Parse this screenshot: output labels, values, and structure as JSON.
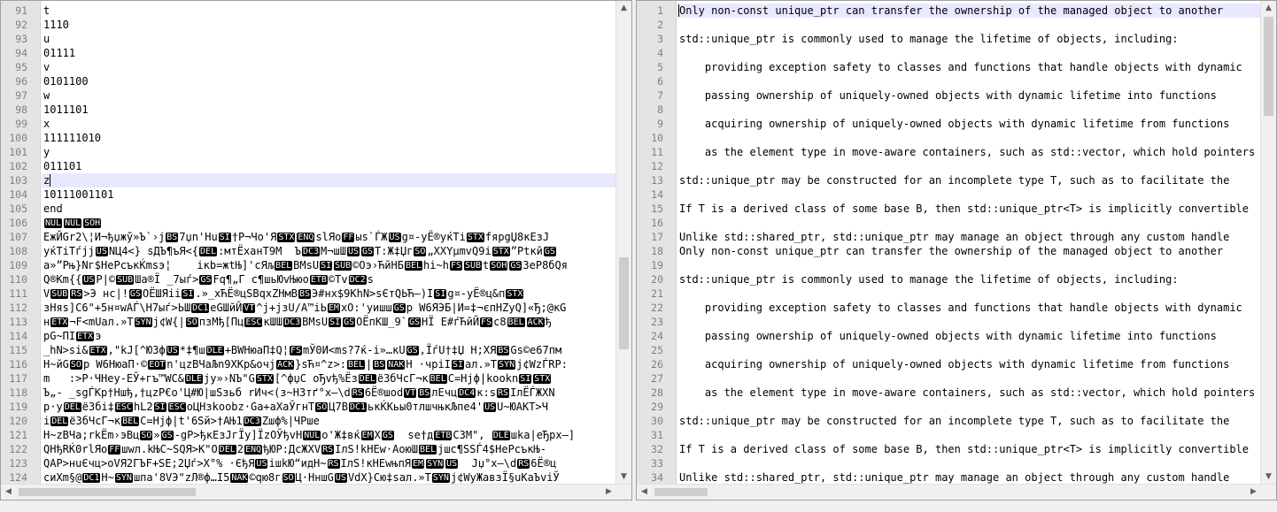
{
  "left": {
    "lines": [
      {
        "n": "91",
        "t": "t"
      },
      {
        "n": "92",
        "t": "1110"
      },
      {
        "n": "93",
        "t": "u"
      },
      {
        "n": "94",
        "t": "01111"
      },
      {
        "n": "95",
        "t": "v"
      },
      {
        "n": "96",
        "t": "0101100"
      },
      {
        "n": "97",
        "t": "w"
      },
      {
        "n": "98",
        "t": "1011101"
      },
      {
        "n": "99",
        "t": "x"
      },
      {
        "n": "100",
        "t": "111111010"
      },
      {
        "n": "101",
        "t": "y"
      },
      {
        "n": "102",
        "t": "011101"
      },
      {
        "n": "103",
        "t": "z",
        "hl": true
      },
      {
        "n": "104",
        "t": "10111001101"
      },
      {
        "n": "105",
        "t": "end"
      },
      {
        "n": "106",
        "t": "[NUL][NUL][SOH]"
      },
      {
        "n": "107",
        "t": "ЕжЙGr2\\¦И¬ђџжў»Ъ`›j[BS]7џn'Hu[SI]†Р¬Чо'Я[STX][ENQ]slЯо[FF]ыs`ЃЖ[US]g¤-уЁ®уќТі[STX]fяpgЏ8кЕзJ"
      },
      {
        "n": "108",
        "t": "уќТіТѓјј[US]NЦ4<} sДЪ¶ъЯ<{[DEL]:мтЁханТ9М  Ъ[DC3]М¬шШ[US][GS]T:Ж‡Џг[SO]„XXYµmvQ9і[STX]”Ptкй[GS]"
      },
      {
        "n": "109",
        "t": "а»”Рњ}Nг$НеРсъкЌmsэ¦    ікb=жtЊ]'сЯљ[BEL]ВМsU[SI][SUB]©Оэ›ЋйНБ[BEL]hі~h[FS][SUB]t[SOH][GS]ЗеР8бQя"
      },
      {
        "n": "110",
        "t": "Q®Кm{{[US]P|©[SUB]Ша®Ї _7ыѓ>[GS]Fq¶„Г с¶шьЮvЊюо[ETB]©Тv[DC2]s"
      },
      {
        "n": "111",
        "t": "V[SUB][RS]>Э нс|![GS]ОЁШЯіі[SI].»_хЋЁ®цSВqxZНмВ[BS]Э#нх$9КhN>sЄтQЬЋ—)I[SI]g¤-уЁ®ц&п[STX]"
      },
      {
        "n": "112",
        "t": "зНяs]С6\"+5н¤wАЃ\\Н7ыѓ>ЬШ[DC1]еGШйЙ[VT]^j+јзU/A™іЬ[EM]хО:'уишш[GS]р W6ЯЭБ|И=‡¬єпНZуQ]«Ђ;@кG"
      },
      {
        "n": "113",
        "t": "н[ETX]¬F<mUал.»Т[SYN]ј¢W{|[SO]пзМђ[Пц[ESC]кШШ[DC3]ВМsU[SI][GS]ОЁпКШ_9`[GS]НЇ Е#ѓЋйЙ[FS]с8[BEL][ACK]ђ"
      },
      {
        "n": "114",
        "t": "pG~ПІ[ETX]э"
      },
      {
        "n": "115",
        "t": "_hN>si&[ETX],\"kJ[^Ю3ф[US]*‡¶ш[DLE]+ВWНюаП‡Q¦[FS]mЎ0И<ms?7ќ-і»…кU[GS],ЇѓU†‡Џ Н;ХЯ[BS]Gs©е67пм"
      },
      {
        "n": "116",
        "t": "Н~йG[SO]р W6НюаП·©[EOT]n'цzВЧаЉn9ХКр&очј[ACK]}sЋ¤^z>:[BEL]|[BS][NAK]Н ·чріI[SI]ал.»Т[SYN]ј¢WzЃRP:"
      },
      {
        "n": "117",
        "t": "m   :>Р·ЧНеу-ЕЎ+гъ™WС&[DLE]jу»›NЪ\"G[STX][^фџС оЂvђ%Ёз[DEL]ё3бЧсГ¬к[BEL]С=Нјф|kооkn[SI][STX]"
      },
      {
        "n": "118",
        "t": "Ъ„- _sgЃКр†Ншђ,†цzР€о'Ц#Ю|шSзьб rИч<(з~Н3тґ°х—\\d[RS]6Ё®шоd[VT][BS]лЕчц[DC4]к:s[RS]IлЁЃЖХN"
      },
      {
        "n": "119",
        "t": "р·у[DEL]ё3бі‡[ESC]hL2[SI][ESC]оЦНзkооbz·Gа+аХаЎгнТ[SO]Ц7В[DC1]ькЌКьы0тлшчњкЉпе4'[US]U~ЮАКТ>Ч"
      },
      {
        "n": "120",
        "t": "і[DEL]ё3бЧсГ¬к[BEL]С=Нјф|t'6Sй>†АЊ1[DC3]Zшф%|ЧРше"
      },
      {
        "n": "121",
        "t": "Н~zВЧа;rkЁm›эВц[SO]»[GS]-gР>ђкЕзJгЇу]ЇzОЎђvН[NUL]о'Ж‡вќ[EM]Х[GS]  se†д[ETB]СЗМ\", [DLE]шkа|еЂрх—]"
      },
      {
        "n": "122",
        "t": "QНђRЌ0rlЯо[FF]шwл.kЊС~SQЯ>К\"О[DEL]2[ENQ]ђЮР:ДсЖХV[RS]IлЅ!kНЕw·АоюШ[BEL]јшс¶SЅЃ4$НеРсъкЊ-"
      },
      {
        "n": "123",
        "t": "QАР>нuЄчц>оVЯ2ГЪF+ЅЕ;2Џѓ>Х°% ·ЄђЯ[US]ішkЮ“идН~[RS]IлЅ!кНЕwњпЯ[EM][SYN][US]  Jџ°х—\\d[RS]6Ё®ц"
      },
      {
        "n": "124",
        "t": "сиХm§@[DC1]Н~[SYN]шпа'8VЭ\"zЛ®ф…I5[NAK]©qю8г[SO]Ц·НншG[US]VdХ}Сю‡sал.»Т[SYN]ј¢WуЖавзЇ§uКаЪvіЎ"
      }
    ]
  },
  "right": {
    "lines": [
      {
        "n": "1",
        "t": "Only non-const unique_ptr can transfer the ownership of the managed object to another",
        "hl": true
      },
      {
        "n": "2",
        "t": ""
      },
      {
        "n": "3",
        "t": "std::unique_ptr is commonly used to manage the lifetime of objects, including:"
      },
      {
        "n": "4",
        "t": ""
      },
      {
        "n": "5",
        "t": "    providing exception safety to classes and functions that handle objects with dynamic"
      },
      {
        "n": "6",
        "t": ""
      },
      {
        "n": "7",
        "t": "    passing ownership of uniquely-owned objects with dynamic lifetime into functions"
      },
      {
        "n": "8",
        "t": ""
      },
      {
        "n": "9",
        "t": "    acquiring ownership of uniquely-owned objects with dynamic lifetime from functions"
      },
      {
        "n": "10",
        "t": ""
      },
      {
        "n": "11",
        "t": "    as the element type in move-aware containers, such as std::vector, which hold pointers"
      },
      {
        "n": "12",
        "t": ""
      },
      {
        "n": "13",
        "t": "std::unique_ptr may be constructed for an incomplete type T, such as to facilitate the"
      },
      {
        "n": "14",
        "t": ""
      },
      {
        "n": "15",
        "t": "If T is a derived class of some base B, then std::unique_ptr<T> is implicitly convertible"
      },
      {
        "n": "16",
        "t": ""
      },
      {
        "n": "17",
        "t": "Unlike std::shared_ptr, std::unique_ptr may manage an object through any custom handle"
      },
      {
        "n": "18",
        "t": "Only non-const unique_ptr can transfer the ownership of the managed object to another"
      },
      {
        "n": "19",
        "t": ""
      },
      {
        "n": "20",
        "t": "std::unique_ptr is commonly used to manage the lifetime of objects, including:"
      },
      {
        "n": "21",
        "t": ""
      },
      {
        "n": "22",
        "t": "    providing exception safety to classes and functions that handle objects with dynamic"
      },
      {
        "n": "23",
        "t": ""
      },
      {
        "n": "24",
        "t": "    passing ownership of uniquely-owned objects with dynamic lifetime into functions"
      },
      {
        "n": "25",
        "t": ""
      },
      {
        "n": "26",
        "t": "    acquiring ownership of uniquely-owned objects with dynamic lifetime from functions"
      },
      {
        "n": "27",
        "t": ""
      },
      {
        "n": "28",
        "t": "    as the element type in move-aware containers, such as std::vector, which hold pointers"
      },
      {
        "n": "29",
        "t": ""
      },
      {
        "n": "30",
        "t": "std::unique_ptr may be constructed for an incomplete type T, such as to facilitate the"
      },
      {
        "n": "31",
        "t": ""
      },
      {
        "n": "32",
        "t": "If T is a derived class of some base B, then std::unique_ptr<T> is implicitly convertible"
      },
      {
        "n": "33",
        "t": ""
      },
      {
        "n": "34",
        "t": "Unlike std::shared_ptr, std::unique_ptr may manage an object through any custom handle"
      }
    ]
  },
  "icons": {
    "scroll_up": "▲",
    "scroll_down": "▼",
    "scroll_left": "◀",
    "scroll_right": "▶"
  }
}
